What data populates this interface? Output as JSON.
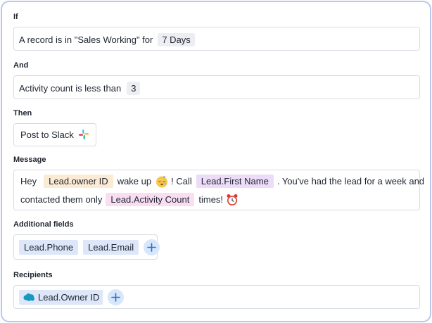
{
  "if_section": {
    "label": "If",
    "text_before": "A record  is in \"Sales Working\" for",
    "days_chip": "7 Days"
  },
  "and_section": {
    "label": "And",
    "text_before": "Activity count is less than",
    "count_chip": "3"
  },
  "then_section": {
    "label": "Then",
    "action": "Post to Slack",
    "action_icon": "slack-icon"
  },
  "message_section": {
    "label": "Message",
    "part1": "Hey",
    "var_owner": "Lead.owner ID",
    "part2": "wake up",
    "part3": "! Call",
    "var_first_name": "Lead.First Name",
    "part4": ". You've had the lead for a week and",
    "part5": "contacted them only",
    "var_activity": "Lead.Activity Count",
    "part6": "times!",
    "emoji_1": "sleepy-face-icon",
    "emoji_2": "alarm-clock-icon"
  },
  "additional_fields": {
    "label": "Additional fields",
    "items": [
      "Lead.Phone",
      "Lead.Email"
    ]
  },
  "recipients": {
    "label": "Recipients",
    "items": [
      "Lead.Owner ID"
    ],
    "item_icon": "salesforce-cloud-icon"
  },
  "colors": {
    "border_accent": "#b9c8ec",
    "chip_yellow": "#fcebd4",
    "chip_purple": "#ecdcf7",
    "chip_pink": "#f9ddf0",
    "chip_blue": "#dde7f9",
    "plus_bg": "#d6e6fb",
    "plus_fg": "#2f6fd8"
  }
}
